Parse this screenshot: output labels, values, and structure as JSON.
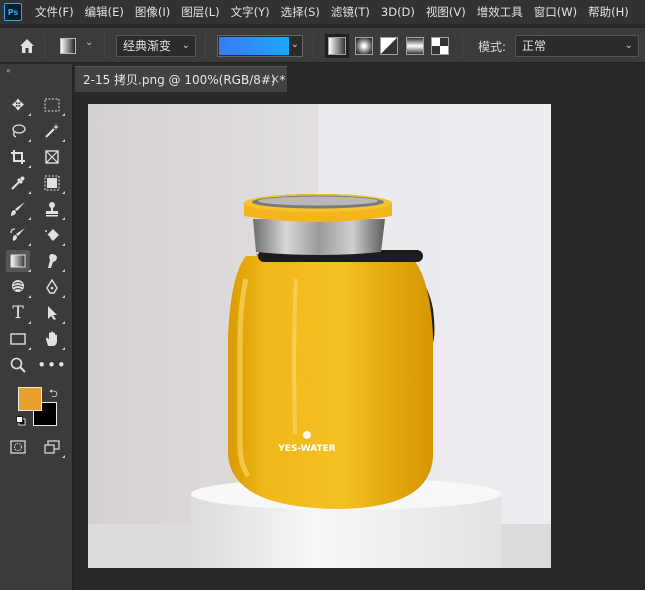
{
  "menubar": {
    "logo": "Ps",
    "items": [
      "文件(F)",
      "编辑(E)",
      "图像(I)",
      "图层(L)",
      "文字(Y)",
      "选择(S)",
      "滤镜(T)",
      "3D(D)",
      "视图(V)",
      "增效工具",
      "窗口(W)",
      "帮助(H)"
    ]
  },
  "options": {
    "gradient_preset": "经典渐变",
    "gradient_colors": [
      "#3a7bf2",
      "#1ea7ff"
    ],
    "mode_label": "模式:",
    "mode_value": "正常"
  },
  "document": {
    "tab_title": "2-15 拷贝.png @ 100%(RGB/8#) *",
    "tab_close": "×",
    "product_brand": "YES-WATER"
  },
  "colors": {
    "foreground": "#e8a12d",
    "background": "#000000",
    "accent": "#31a8ff"
  },
  "tools": [
    "move-icon",
    "marquee-icon",
    "lasso-icon",
    "magic-wand-icon",
    "crop-icon",
    "frame-icon",
    "eyedropper-icon",
    "object-select-icon",
    "brush-icon",
    "stamp-icon",
    "history-brush-icon",
    "eraser-icon",
    "gradient-icon",
    "smudge-icon",
    "dodge-icon",
    "pen-icon",
    "type-icon",
    "path-select-icon",
    "rectangle-icon",
    "hand-icon",
    "zoom-icon",
    "more-icon",
    "quick-mask-icon",
    "screen-mode-icon"
  ]
}
